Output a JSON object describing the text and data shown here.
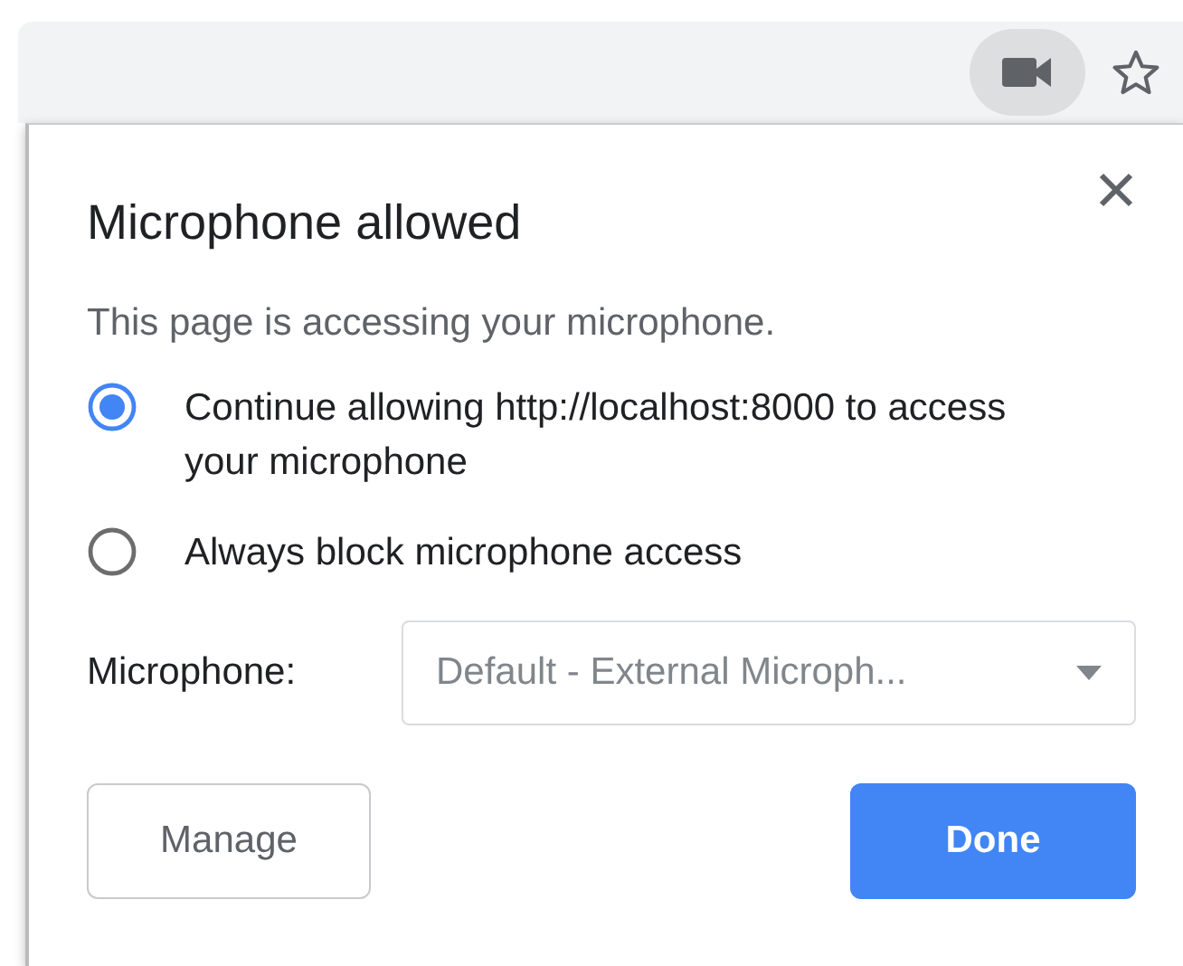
{
  "toolbar": {
    "camera_active": true
  },
  "dialog": {
    "title": "Microphone allowed",
    "message": "This page is accessing your microphone.",
    "options": [
      {
        "label": "Continue allowing http://localhost:8000 to access your microphone",
        "selected": true
      },
      {
        "label": "Always block microphone access",
        "selected": false
      }
    ],
    "device": {
      "label": "Microphone:",
      "value": "Default - External Microph..."
    },
    "buttons": [
      {
        "label": "Manage",
        "kind": "secondary"
      },
      {
        "label": "Done",
        "kind": "primary"
      }
    ]
  }
}
